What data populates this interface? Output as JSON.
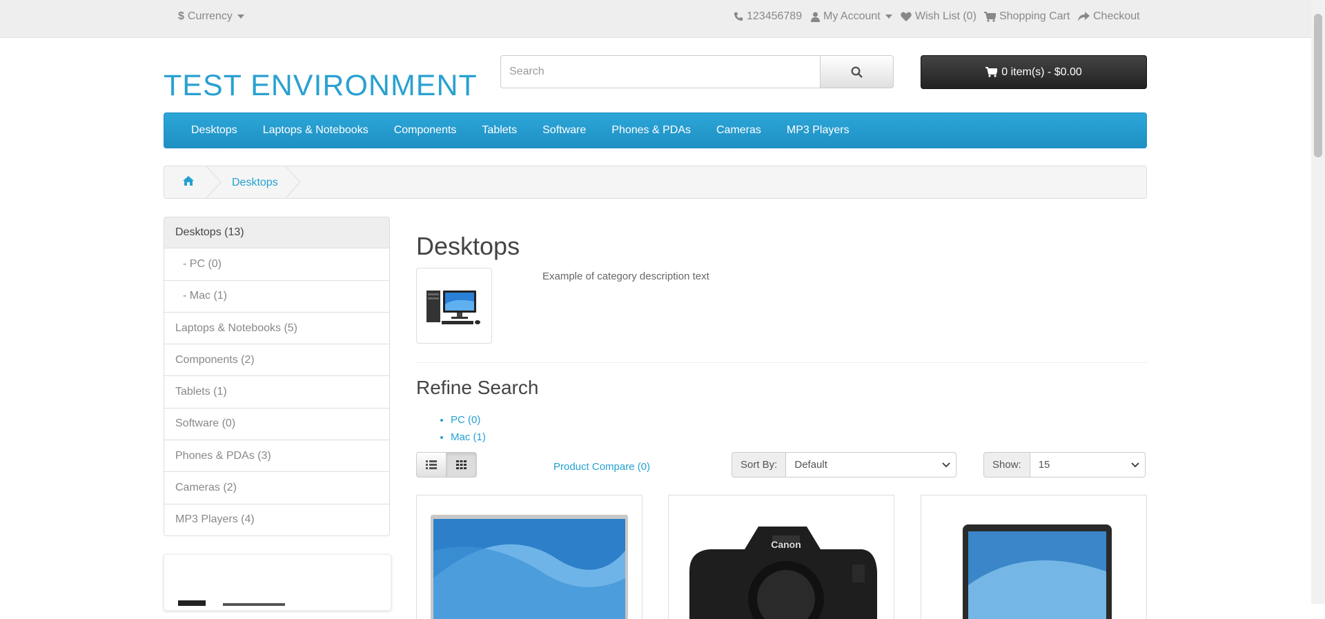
{
  "topbar": {
    "currency": "Currency",
    "phone": "123456789",
    "my_account": "My Account",
    "wishlist": "Wish List (0)",
    "shopping_cart": "Shopping Cart",
    "checkout": "Checkout"
  },
  "header": {
    "logo": "TEST ENVIRONMENT",
    "search_placeholder": "Search",
    "cart_label": "0 item(s) - $0.00"
  },
  "menu": {
    "items": [
      "Desktops",
      "Laptops & Notebooks",
      "Components",
      "Tablets",
      "Software",
      "Phones & PDAs",
      "Cameras",
      "MP3 Players"
    ]
  },
  "breadcrumb": {
    "current": "Desktops"
  },
  "sidebar": {
    "categories": [
      "Desktops (13)",
      "- PC (0)",
      "- Mac (1)",
      "Laptops & Notebooks (5)",
      "Components (2)",
      "Tablets (1)",
      "Software (0)",
      "Phones & PDAs (3)",
      "Cameras (2)",
      "MP3 Players (4)"
    ]
  },
  "content": {
    "title": "Desktops",
    "description": "Example of category description text",
    "refine_title": "Refine Search",
    "refine_links": [
      "PC (0)",
      "Mac (1)"
    ],
    "product_compare": "Product Compare (0)",
    "sort_label": "Sort By:",
    "sort_value": "Default",
    "show_label": "Show:",
    "show_value": "15"
  },
  "colors": {
    "accent": "#23a1d1",
    "menu": "#229ac8",
    "cart": "#363636"
  }
}
